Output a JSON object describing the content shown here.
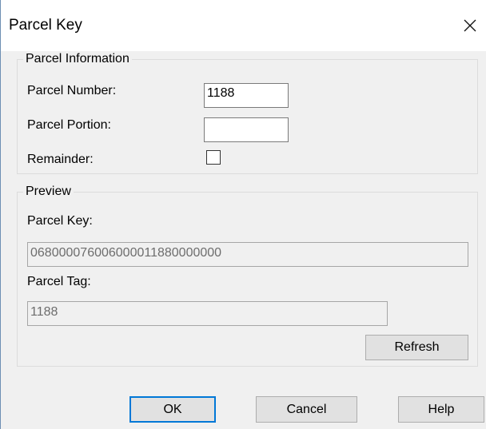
{
  "dialog": {
    "title": "Parcel Key"
  },
  "parcel_information": {
    "legend": "Parcel Information",
    "parcel_number_label": "Parcel Number:",
    "parcel_number_value": "1188",
    "parcel_portion_label": "Parcel Portion:",
    "parcel_portion_value": "",
    "remainder_label": "Remainder:",
    "remainder_checked": false
  },
  "preview": {
    "legend": "Preview",
    "parcel_key_label": "Parcel Key:",
    "parcel_key_value": "068000076006000011880000000",
    "parcel_tag_label": "Parcel Tag:",
    "parcel_tag_value": "1188",
    "refresh_label": "Refresh"
  },
  "buttons": {
    "ok": "OK",
    "cancel": "Cancel",
    "help": "Help"
  },
  "colors": {
    "accent": "#0078d7",
    "dialog_bg": "#f0f0f0",
    "titlebar_bg": "#ffffff"
  },
  "icons": {
    "close": "close-icon"
  }
}
